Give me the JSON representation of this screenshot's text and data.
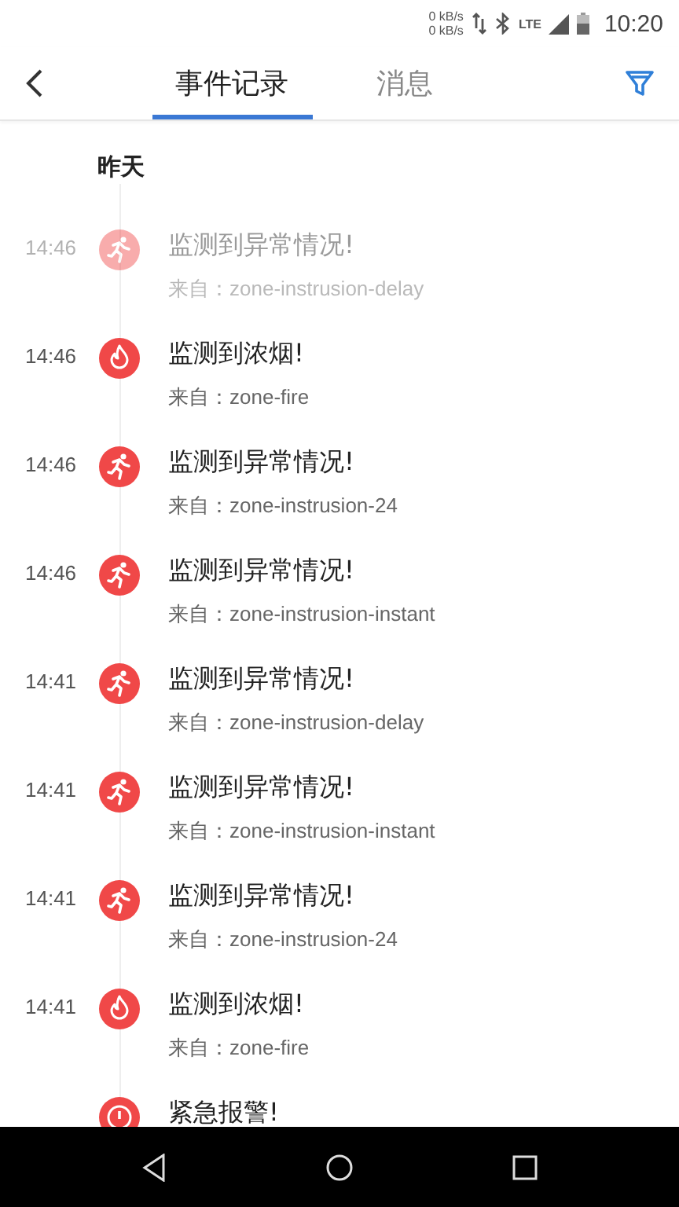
{
  "status_bar": {
    "net_up": "0 kB/s",
    "net_down": "0 kB/s",
    "network": "LTE",
    "time": "10:20"
  },
  "tabs": [
    {
      "label": "事件记录",
      "selected": true
    },
    {
      "label": "消息",
      "selected": false
    }
  ],
  "section": "昨天",
  "events": [
    {
      "time": "14:46",
      "kind": "intrusion",
      "title": "监测到异常情况!",
      "source": "来自：zone-instrusion-delay",
      "dimmed": true
    },
    {
      "time": "14:46",
      "kind": "fire",
      "title": "监测到浓烟!",
      "source": "来自：zone-fire",
      "dimmed": false
    },
    {
      "time": "14:46",
      "kind": "intrusion",
      "title": "监测到异常情况!",
      "source": "来自：zone-instrusion-24",
      "dimmed": false
    },
    {
      "time": "14:46",
      "kind": "intrusion",
      "title": "监测到异常情况!",
      "source": "来自：zone-instrusion-instant",
      "dimmed": false
    },
    {
      "time": "14:41",
      "kind": "intrusion",
      "title": "监测到异常情况!",
      "source": "来自：zone-instrusion-delay",
      "dimmed": false
    },
    {
      "time": "14:41",
      "kind": "intrusion",
      "title": "监测到异常情况!",
      "source": "来自：zone-instrusion-instant",
      "dimmed": false
    },
    {
      "time": "14:41",
      "kind": "intrusion",
      "title": "监测到异常情况!",
      "source": "来自：zone-instrusion-24",
      "dimmed": false
    },
    {
      "time": "14:41",
      "kind": "fire",
      "title": "监测到浓烟!",
      "source": "来自：zone-fire",
      "dimmed": false
    },
    {
      "kind": "emergency",
      "title": "紧急报警!",
      "dimmed": false
    }
  ]
}
